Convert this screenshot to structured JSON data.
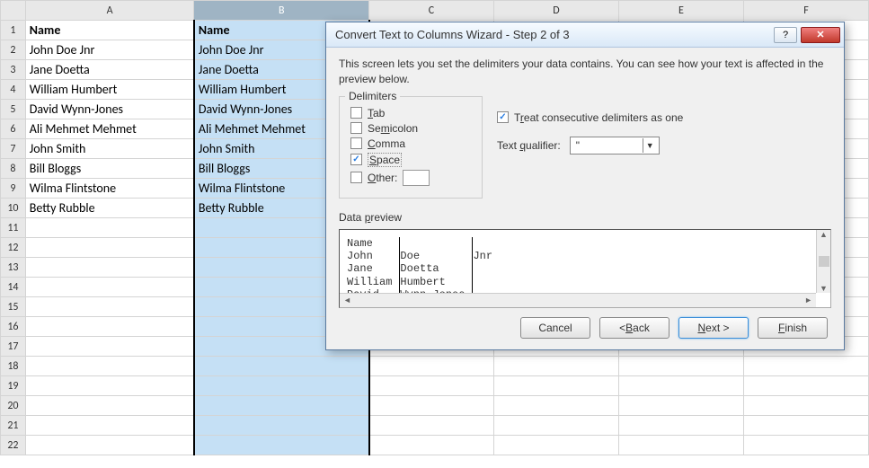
{
  "columns": [
    "A",
    "B",
    "C",
    "D",
    "E",
    "F"
  ],
  "rows": [
    {
      "n": "1",
      "a": "Name",
      "b": "Name"
    },
    {
      "n": "2",
      "a": "John Doe Jnr",
      "b": "John Doe Jnr"
    },
    {
      "n": "3",
      "a": "Jane Doetta",
      "b": "Jane Doetta"
    },
    {
      "n": "4",
      "a": "William Humbert",
      "b": "William Humbert"
    },
    {
      "n": "5",
      "a": "David Wynn-Jones",
      "b": "David Wynn-Jones"
    },
    {
      "n": "6",
      "a": "Ali Mehmet Mehmet",
      "b": "Ali Mehmet Mehmet"
    },
    {
      "n": "7",
      "a": "John Smith",
      "b": "John Smith"
    },
    {
      "n": "8",
      "a": "Bill Bloggs",
      "b": "Bill Bloggs"
    },
    {
      "n": "9",
      "a": "Wilma Flintstone",
      "b": "Wilma Flintstone"
    },
    {
      "n": "10",
      "a": "Betty Rubble",
      "b": "Betty Rubble"
    },
    {
      "n": "11",
      "a": "",
      "b": ""
    },
    {
      "n": "12",
      "a": "",
      "b": ""
    },
    {
      "n": "13",
      "a": "",
      "b": ""
    },
    {
      "n": "14",
      "a": "",
      "b": ""
    },
    {
      "n": "15",
      "a": "",
      "b": ""
    },
    {
      "n": "16",
      "a": "",
      "b": ""
    },
    {
      "n": "17",
      "a": "",
      "b": ""
    },
    {
      "n": "18",
      "a": "",
      "b": ""
    },
    {
      "n": "19",
      "a": "",
      "b": ""
    },
    {
      "n": "20",
      "a": "",
      "b": ""
    },
    {
      "n": "21",
      "a": "",
      "b": ""
    },
    {
      "n": "22",
      "a": "",
      "b": ""
    }
  ],
  "dialog": {
    "title": "Convert Text to Columns Wizard - Step 2 of 3",
    "description": "This screen lets you set the delimiters your data contains.  You can see how your text is affected in the preview below.",
    "delimiters_legend": "Delimiters",
    "opts": {
      "tab": "Tab",
      "semicolon": "Semicolon",
      "comma": "Comma",
      "space": "Space",
      "other": "Other:",
      "treat": "Treat consecutive delimiters as one",
      "qualifier_label": "Text qualifier:",
      "qualifier_value": "\""
    },
    "checked": {
      "tab": false,
      "semicolon": false,
      "comma": false,
      "space": true,
      "other": false,
      "treat": true
    },
    "preview_label": "Data preview",
    "preview": {
      "col1": "Name\nJohn\nJane\nWilliam\nDavid",
      "col2": "\nDoe\nDoetta\nHumbert\nWynn-Jones",
      "col3": "\nJnr\n\n\n"
    },
    "buttons": {
      "cancel": "Cancel",
      "back": "< Back",
      "next": "Next >",
      "finish": "Finish"
    },
    "help_icon": "?",
    "close_icon": "✕"
  }
}
